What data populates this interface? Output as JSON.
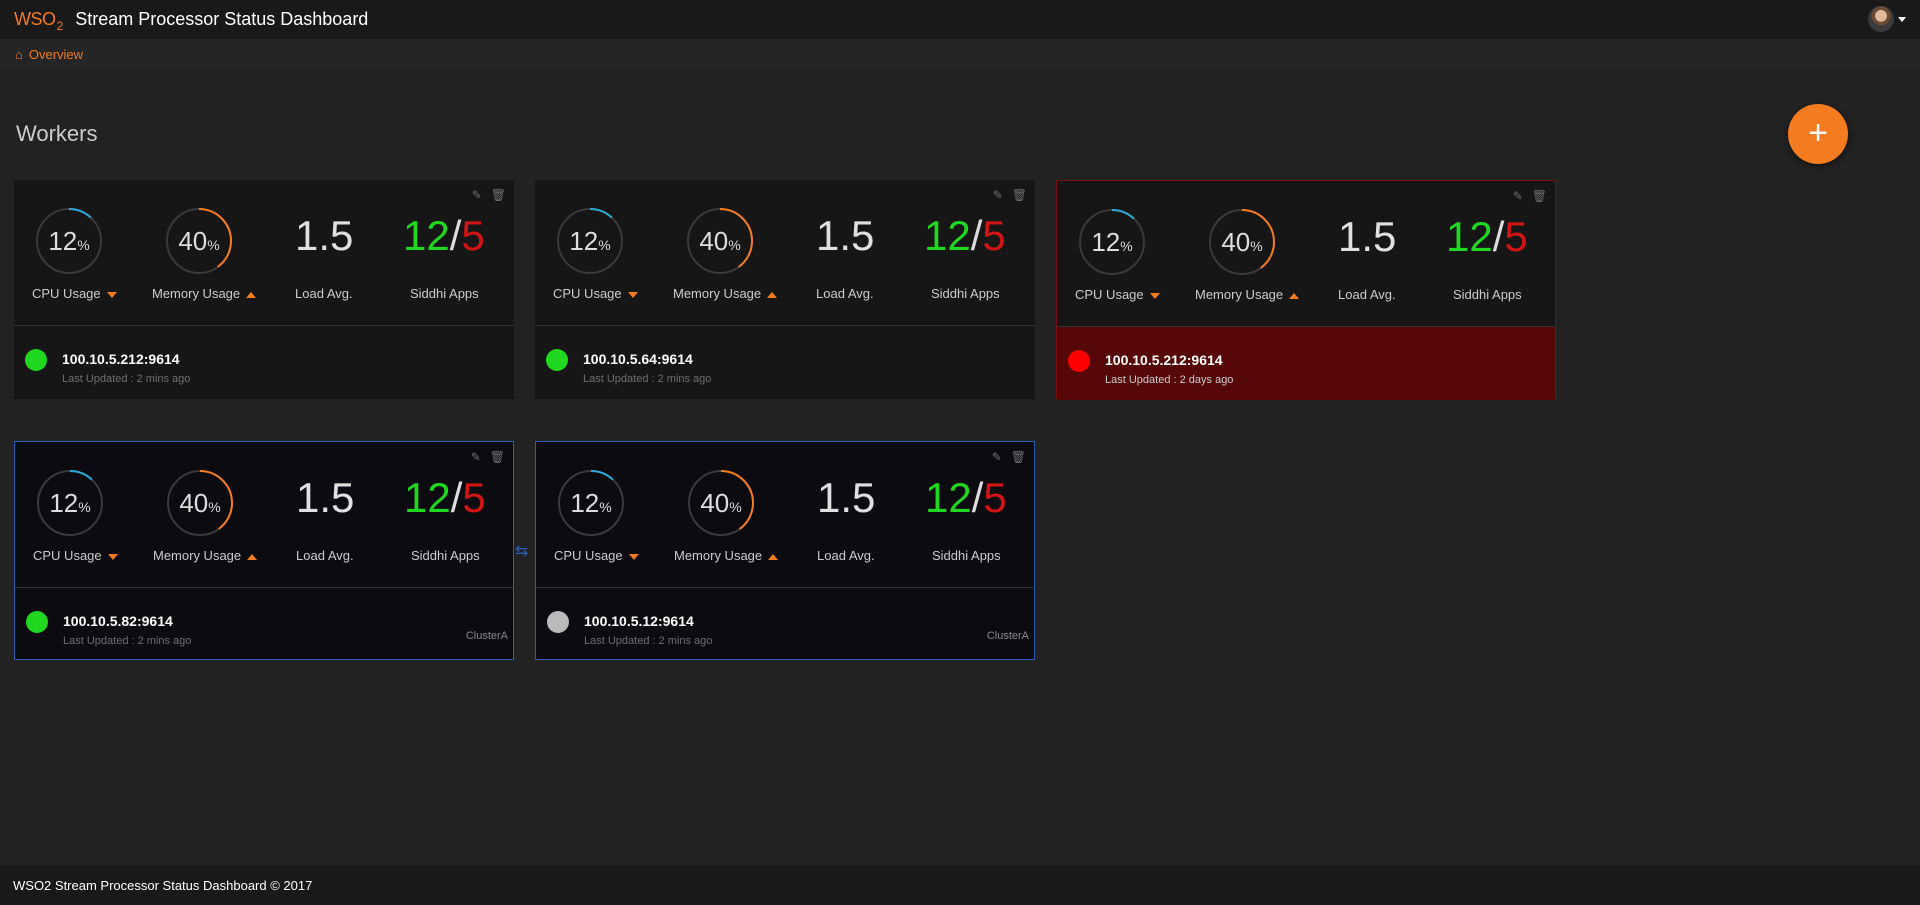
{
  "header": {
    "logo_text": "WSO",
    "logo_sub": "2",
    "title": "Stream Processor Status Dashboard",
    "user_icon": "user-avatar"
  },
  "breadcrumb": {
    "home_icon": "home-icon",
    "label": "Overview"
  },
  "page": {
    "title": "Workers",
    "add_label": "+"
  },
  "labels": {
    "cpu": "CPU Usage",
    "memory": "Memory Usage",
    "load": "Load Avg.",
    "apps": "Siddhi Apps",
    "percent": "%"
  },
  "colors": {
    "accent": "#f47b20",
    "cpu_arc": "#2aa9d6",
    "status_green": "#1fd81f",
    "status_red": "#ff0000",
    "status_grey": "#bbbbbb",
    "cluster_border": "#2a5db3",
    "error_bg": "#560707"
  },
  "workers": [
    {
      "cpu": 12,
      "memory": 40,
      "load": "1.5",
      "apps_active": "12",
      "apps_inactive": "5",
      "host": "100.10.5.212:9614",
      "updated": "Last Updated : 2 mins ago",
      "status": "green",
      "cluster": ""
    },
    {
      "cpu": 12,
      "memory": 40,
      "load": "1.5",
      "apps_active": "12",
      "apps_inactive": "5",
      "host": "100.10.5.64:9614",
      "updated": "Last Updated : 2 mins ago",
      "status": "green",
      "cluster": ""
    },
    {
      "cpu": 12,
      "memory": 40,
      "load": "1.5",
      "apps_active": "12",
      "apps_inactive": "5",
      "host": "100.10.5.212:9614",
      "updated": "Last Updated : 2 days ago",
      "status": "red",
      "cluster": ""
    },
    {
      "cpu": 12,
      "memory": 40,
      "load": "1.5",
      "apps_active": "12",
      "apps_inactive": "5",
      "host": "100.10.5.82:9614",
      "updated": "Last Updated : 2 mins ago",
      "status": "green",
      "cluster": "ClusterA"
    },
    {
      "cpu": 12,
      "memory": 40,
      "load": "1.5",
      "apps_active": "12",
      "apps_inactive": "5",
      "host": "100.10.5.12:9614",
      "updated": "Last Updated : 2 mins ago",
      "status": "grey",
      "cluster": "ClusterA"
    }
  ],
  "footer": {
    "text": "WSO2 Stream Processor Status Dashboard © 2017"
  }
}
